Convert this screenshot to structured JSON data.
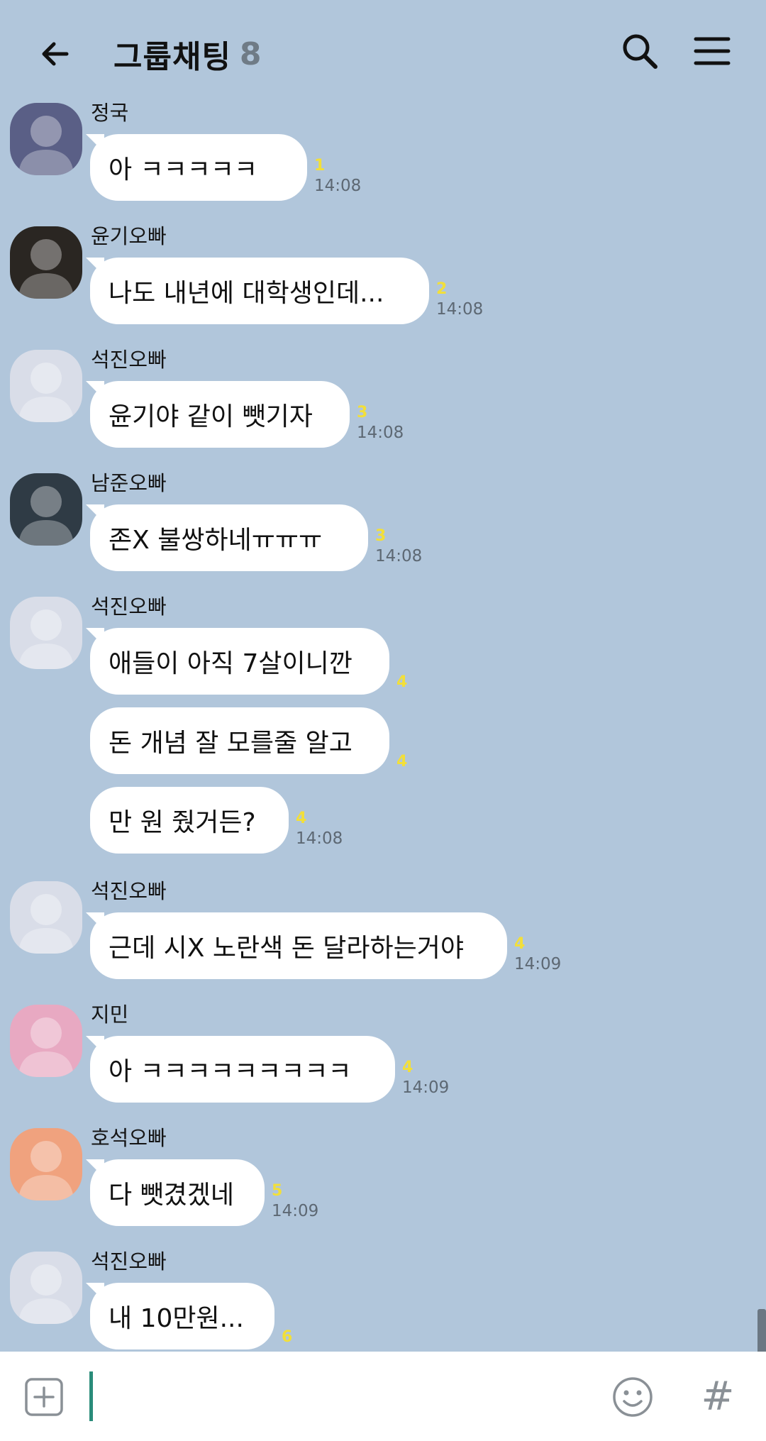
{
  "header": {
    "title": "그룹채팅",
    "member_count": "8",
    "back_icon": "arrow-left-icon",
    "search_icon": "search-icon",
    "menu_icon": "hamburger-menu-icon"
  },
  "messages": [
    {
      "sender": "정국",
      "avatar_color": "#5a5f86",
      "bubbles": [
        {
          "text": "아 ㅋㅋㅋㅋㅋ",
          "unread": "1",
          "time": "14:08"
        }
      ]
    },
    {
      "sender": "윤기오빠",
      "avatar_color": "#2a2622",
      "bubbles": [
        {
          "text": "나도 내년에 대학생인데...",
          "unread": "2",
          "time": "14:08"
        }
      ]
    },
    {
      "sender": "석진오빠",
      "avatar_color": "#d9dde8",
      "bubbles": [
        {
          "text": "윤기야 같이 뺏기자",
          "unread": "3",
          "time": "14:08"
        }
      ]
    },
    {
      "sender": "남준오빠",
      "avatar_color": "#2f3b45",
      "bubbles": [
        {
          "text": "존X 불쌍하네ㅠㅠㅠ",
          "unread": "3",
          "time": "14:08"
        }
      ]
    },
    {
      "sender": "석진오빠",
      "avatar_color": "#d9dde8",
      "bubbles": [
        {
          "text": "애들이 아직 7살이니깐",
          "unread": "4",
          "time": ""
        },
        {
          "text": "돈 개념 잘 모를줄 알고",
          "unread": "4",
          "time": ""
        },
        {
          "text": "만 원 줬거든?",
          "unread": "4",
          "time": "14:08"
        }
      ]
    },
    {
      "sender": "석진오빠",
      "avatar_color": "#d9dde8",
      "bubbles": [
        {
          "text": "근데 시X 노란색 돈 달라하는거야",
          "unread": "4",
          "time": "14:09"
        }
      ]
    },
    {
      "sender": "지민",
      "avatar_color": "#e8a9c2",
      "bubbles": [
        {
          "text": "아 ㅋㅋㅋㅋㅋㅋㅋㅋㅋ",
          "unread": "4",
          "time": "14:09"
        }
      ]
    },
    {
      "sender": "호석오빠",
      "avatar_color": "#f0a27e",
      "bubbles": [
        {
          "text": "다 뺏겼겠네",
          "unread": "5",
          "time": "14:09"
        }
      ]
    },
    {
      "sender": "석진오빠",
      "avatar_color": "#d9dde8",
      "bubbles": [
        {
          "text": "내 10만원...",
          "unread": "6",
          "time": ""
        }
      ]
    }
  ],
  "input": {
    "plus_icon": "plus-square-icon",
    "emoji_icon": "smiley-icon",
    "hash_label": "#"
  }
}
